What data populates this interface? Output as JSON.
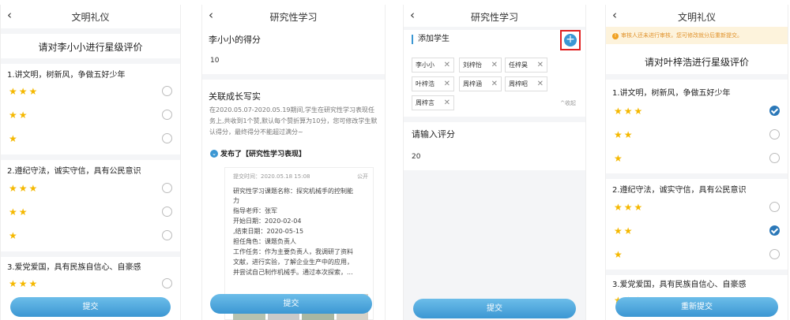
{
  "panel1": {
    "title": "文明礼仪",
    "heading": "请对李小小进行星级评价",
    "questions": [
      {
        "label": "1.讲文明，树新风，争做五好少年",
        "rows": [
          "★★★",
          "★★",
          "★"
        ]
      },
      {
        "label": "2.遵纪守法，诚实守信，具有公民意识",
        "rows": [
          "★★★",
          "★★",
          "★"
        ]
      },
      {
        "label": "3.爱党爱国，具有民族自信心、自豪感",
        "rows": [
          "★★★"
        ]
      }
    ],
    "submit": "提交"
  },
  "panel2": {
    "title": "研究性学习",
    "score_label": "李小小的得分",
    "score": "10",
    "link_title": "关联成长写实",
    "desc": "在2020.05.07-2020.05.19期间,学生在研究性学习表现任务上,共收到1个赞,默认每个赞折算为10分，您可修改学生默认得分，最终得分不能超过满分~",
    "published": "发布了【研究性学习表现】",
    "card": {
      "time": "提交时间：2020.05.18 15:08",
      "visibility": "公开",
      "lines": [
        "研究性学习课题名称：探究机械手的控制能",
        "力",
        "指导老师：张军",
        "开始日期：2020-02-04",
        ",结束日期：2020-05-15",
        "担任角色：课题负责人",
        "工作任务：作为主要负责人，我调研了资料",
        "文献，进行实验，了解企业生产中的应用，",
        "并尝试自己制作机械手。通过本次探索，..."
      ]
    },
    "submit": "提交"
  },
  "panel3": {
    "title": "研究性学习",
    "add_label": "添加学生",
    "add_icon": "plus-circle-icon",
    "students": [
      "李小小",
      "刘梓怡",
      "任梓昊",
      "叶梓浩",
      "周梓涵",
      "周梓昭",
      "周梓言"
    ],
    "collapse": "^收起",
    "score_label": "请输入评分",
    "score": "20",
    "submit": "提交"
  },
  "panel4": {
    "title": "文明礼仪",
    "notice": "审核人还未进行审核，您可修改就分后重新提交。",
    "heading": "请对叶梓浩进行星级评价",
    "questions": [
      {
        "label": "1.讲文明，树新风，争做五好少年",
        "rows": [
          "★★★",
          "★★",
          "★"
        ],
        "checked": 0
      },
      {
        "label": "2.遵纪守法，诚实守信，具有公民意识",
        "rows": [
          "★★★",
          "★★",
          "★"
        ],
        "checked": 1
      },
      {
        "label": "3.爱党爱国，具有民族自信心、自豪感",
        "rows": [
          "★★★"
        ],
        "checked": -1
      }
    ],
    "submit": "重新提交"
  }
}
